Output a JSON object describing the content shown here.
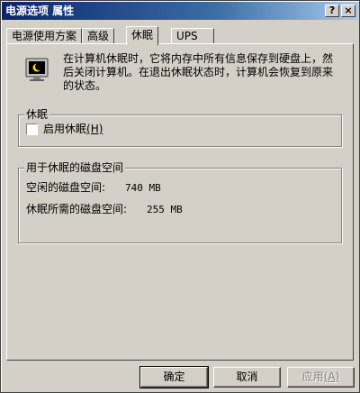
{
  "window": {
    "title": "电源选项 属性",
    "help_glyph": "?",
    "close_glyph": "×"
  },
  "tabs": [
    {
      "label": "电源使用方案"
    },
    {
      "label": "高级"
    },
    {
      "label": "休眠",
      "active": true
    },
    {
      "label": "UPS"
    }
  ],
  "hibernate_tab": {
    "intro_text": "在计算机休眠时，它将内存中所有信息保存到硬盘上，然后关闭计算机。在退出休眠状态时，计算机会恢复到原来的状态。",
    "intro_icon": "hibernate-monitor-icon",
    "hibernate_group": {
      "legend": "休眠",
      "checkbox_label": "启用休眠",
      "checkbox_hotkey": "(H)",
      "checked": false
    },
    "disk_group": {
      "legend": "用于休眠的磁盘空间",
      "free_label": "空闲的磁盘空间:",
      "free_value": "740 MB",
      "required_label": "休眠所需的磁盘空间:",
      "required_value": "255 MB"
    }
  },
  "buttons": {
    "ok": "确定",
    "cancel": "取消",
    "apply": "应用",
    "apply_hotkey": "(A)"
  }
}
